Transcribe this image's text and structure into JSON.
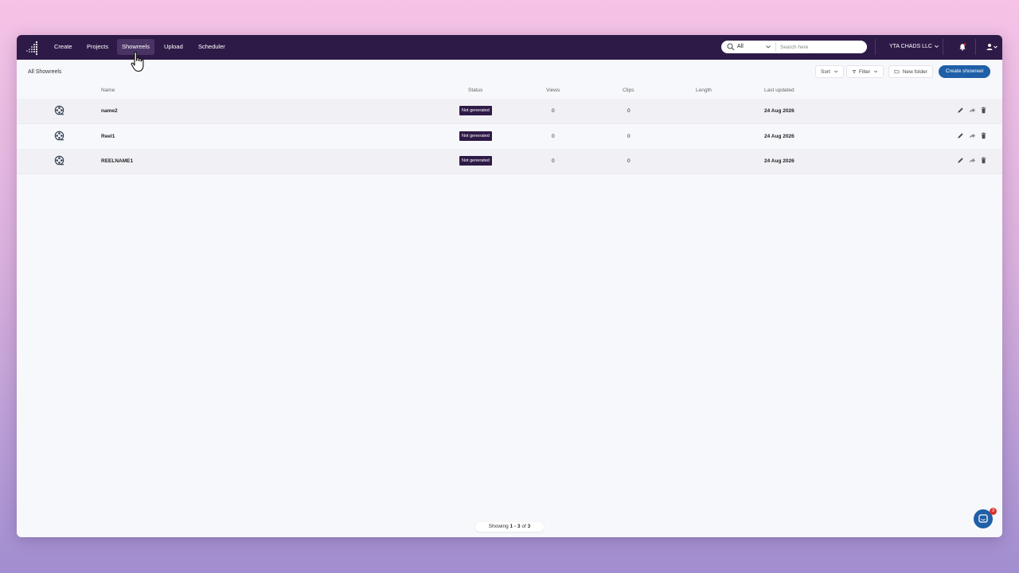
{
  "nav": {
    "items": [
      {
        "label": "Create"
      },
      {
        "label": "Projects"
      },
      {
        "label": "Showreels",
        "active": true
      },
      {
        "label": "Upload"
      },
      {
        "label": "Scheduler"
      }
    ]
  },
  "search": {
    "scope": "All",
    "placeholder": "Search here"
  },
  "org": {
    "name": "YTA CHADS LLC"
  },
  "toolbar": {
    "title": "All Showreels",
    "sort_label": "Sort",
    "filter_label": "Filter",
    "new_folder_label": "New folder",
    "create_label": "Create showreel"
  },
  "table": {
    "columns": {
      "name": "Name",
      "status": "Status",
      "views": "Views",
      "clips": "Clips",
      "length": "Length",
      "updated": "Last updated"
    },
    "rows": [
      {
        "name": "name2",
        "status": "Not generated",
        "views": "0",
        "clips": "0",
        "length": "",
        "updated": "24 Aug 2026"
      },
      {
        "name": "Reel1",
        "status": "Not generated",
        "views": "0",
        "clips": "0",
        "length": "",
        "updated": "24 Aug 2026"
      },
      {
        "name": "REELNAME1",
        "status": "Not generated",
        "views": "0",
        "clips": "0",
        "length": "",
        "updated": "24 Aug 2026"
      }
    ]
  },
  "pager": {
    "prefix": "Showing ",
    "range": "1 - 3",
    "mid": " of ",
    "total": "3"
  },
  "chat": {
    "badge_count": "3"
  },
  "colors": {
    "topbar": "#2e1a47",
    "accent": "#1f5fa8",
    "badge": "#2e1a47",
    "notification": "#d9342b"
  },
  "icons": {
    "logo": "logo-icon",
    "search": "search-icon",
    "reel": "film-reel-icon",
    "edit": "pencil-icon",
    "share": "share-icon",
    "delete": "trash-icon",
    "chat": "chat-icon"
  }
}
